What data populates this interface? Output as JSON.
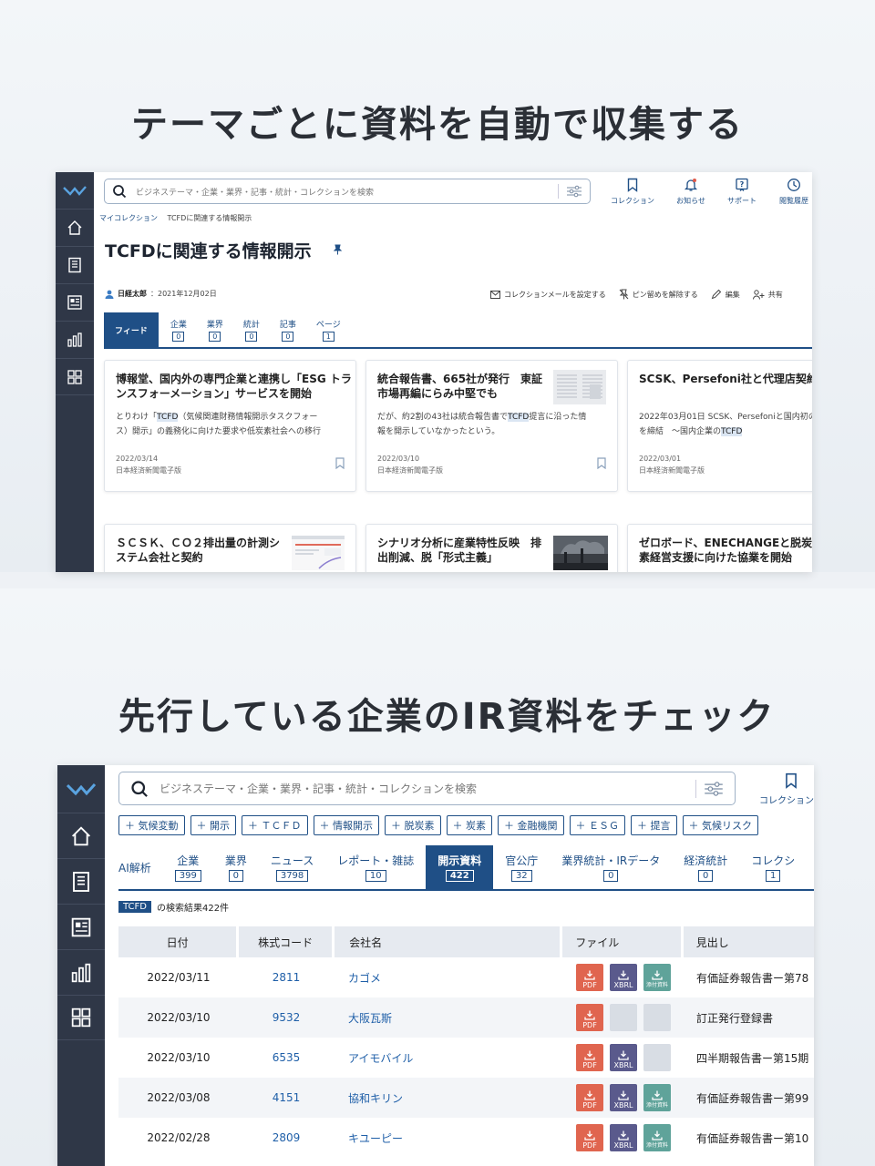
{
  "section1": {
    "headline": "テーマごとに資料を自動で収集する",
    "search_placeholder": "ビジネステーマ・企業・業界・記事・統計・コレクションを検索",
    "top_icons": [
      "コレクション",
      "お知らせ",
      "サポート",
      "閲覧履歴"
    ],
    "breadcrumb": [
      "マイコレクション",
      "TCFDに関連する情報開示"
    ],
    "page_title": "TCFDに関連する情報開示",
    "owner": {
      "name": "日経太郎",
      "date": "：2021年12月02日"
    },
    "actions": [
      "コレクションメールを設定する",
      "ピン留めを解除する",
      "編集",
      "共有"
    ],
    "tabs": [
      {
        "label": "フィード",
        "count": ""
      },
      {
        "label": "企業",
        "count": "0"
      },
      {
        "label": "業界",
        "count": "0"
      },
      {
        "label": "統計",
        "count": "0"
      },
      {
        "label": "記事",
        "count": "0"
      },
      {
        "label": "ページ",
        "count": "1"
      }
    ],
    "cards": [
      {
        "title1": "博報堂、国内外の専門企業と連携し「ESG トラ",
        "title2": "ンスフォーメーション」サービスを開始",
        "s1a": "とりわけ「",
        "s1m": "TCFD",
        "s1b": "（気候関連財務情報開示タスクフォー",
        "s2": "ス）開示」の義務化に向けた要求や低炭素社会への移行",
        "date": "2022/03/14",
        "source": "日本経済新聞電子版"
      },
      {
        "title1": "統合報告書、665社が発行　東証",
        "title2": "市場再編にらみ中堅でも",
        "s1a": "だが、約2割の43社は統合報告書で",
        "s1m": "TCFD",
        "s1b": "提言に沿った情",
        "s2": "報を開示していなかったという。",
        "date": "2022/03/10",
        "source": "日本経済新聞電子版"
      },
      {
        "title1": "SCSK、Persefoni社と代理店契約を",
        "title2": "",
        "s1a": "2022年03月01日 SCSK、Persefoniと国内初の",
        "s1m": "",
        "s1b": "",
        "s2a": "を締結　～国内企業の",
        "s2m": "TCFD",
        "date": "2022/03/01",
        "source": "日本経済新聞電子版"
      },
      {
        "title1": "ＳＣＳＫ、ＣＯ２排出量の計測シ",
        "title2": "ステム会社と契約"
      },
      {
        "title1": "シナリオ分析に産業特性反映　排",
        "title2": "出削減、脱「形式主義」"
      },
      {
        "title1": "ゼロボード、ENECHANGEと脱炭",
        "title2": "素経営支援に向けた協業を開始"
      }
    ]
  },
  "section2": {
    "headline": "先行している企業のIR資料をチェック",
    "search_placeholder": "ビジネステーマ・企業・業界・記事・統計・コレクションを検索",
    "top_icon": "コレクション",
    "chips": [
      "＋ 気候変動",
      "＋ 開示",
      "＋ ＴＣＦＤ",
      "＋ 情報開示",
      "＋ 脱炭素",
      "＋ 炭素",
      "＋ 金融機関",
      "＋ ＥＳＧ",
      "＋ 提言",
      "＋ 気候リスク"
    ],
    "tabs": [
      {
        "label": "AI解析",
        "count": ""
      },
      {
        "label": "企業",
        "count": "399"
      },
      {
        "label": "業界",
        "count": "0"
      },
      {
        "label": "ニュース",
        "count": "3798"
      },
      {
        "label": "レポート・雑誌",
        "count": "10"
      },
      {
        "label": "開示資料",
        "count": "422"
      },
      {
        "label": "官公庁",
        "count": "32"
      },
      {
        "label": "業界統計・IRデータ",
        "count": "0"
      },
      {
        "label": "経済統計",
        "count": "0"
      },
      {
        "label": "コレクシ",
        "count": "1"
      }
    ],
    "result_tag": "TCFD",
    "result_text": "の検索結果422件",
    "table_headers": [
      "日付",
      "株式コード",
      "会社名",
      "ファイル",
      "見出し"
    ],
    "file_labels": {
      "pdf": "PDF",
      "xbrl": "XBRL",
      "att": "添付資料"
    },
    "rows": [
      {
        "date": "2022/03/11",
        "code": "2811",
        "company": "カゴメ",
        "files": [
          "pdf",
          "xbrl",
          "att"
        ],
        "heading": "有価証券報告書ー第78"
      },
      {
        "date": "2022/03/10",
        "code": "9532",
        "company": "大阪瓦斯",
        "files": [
          "pdf",
          "empty",
          "empty"
        ],
        "heading": "訂正発行登録書"
      },
      {
        "date": "2022/03/10",
        "code": "6535",
        "company": "アイモバイル",
        "files": [
          "pdf",
          "xbrl",
          "empty"
        ],
        "heading": "四半期報告書ー第15期"
      },
      {
        "date": "2022/03/08",
        "code": "4151",
        "company": "協和キリン",
        "files": [
          "pdf",
          "xbrl",
          "att"
        ],
        "heading": "有価証券報告書ー第99"
      },
      {
        "date": "2022/02/28",
        "code": "2809",
        "company": "キユーピー",
        "files": [
          "pdf",
          "xbrl",
          "att"
        ],
        "heading": "有価証券報告書ー第10"
      }
    ]
  }
}
